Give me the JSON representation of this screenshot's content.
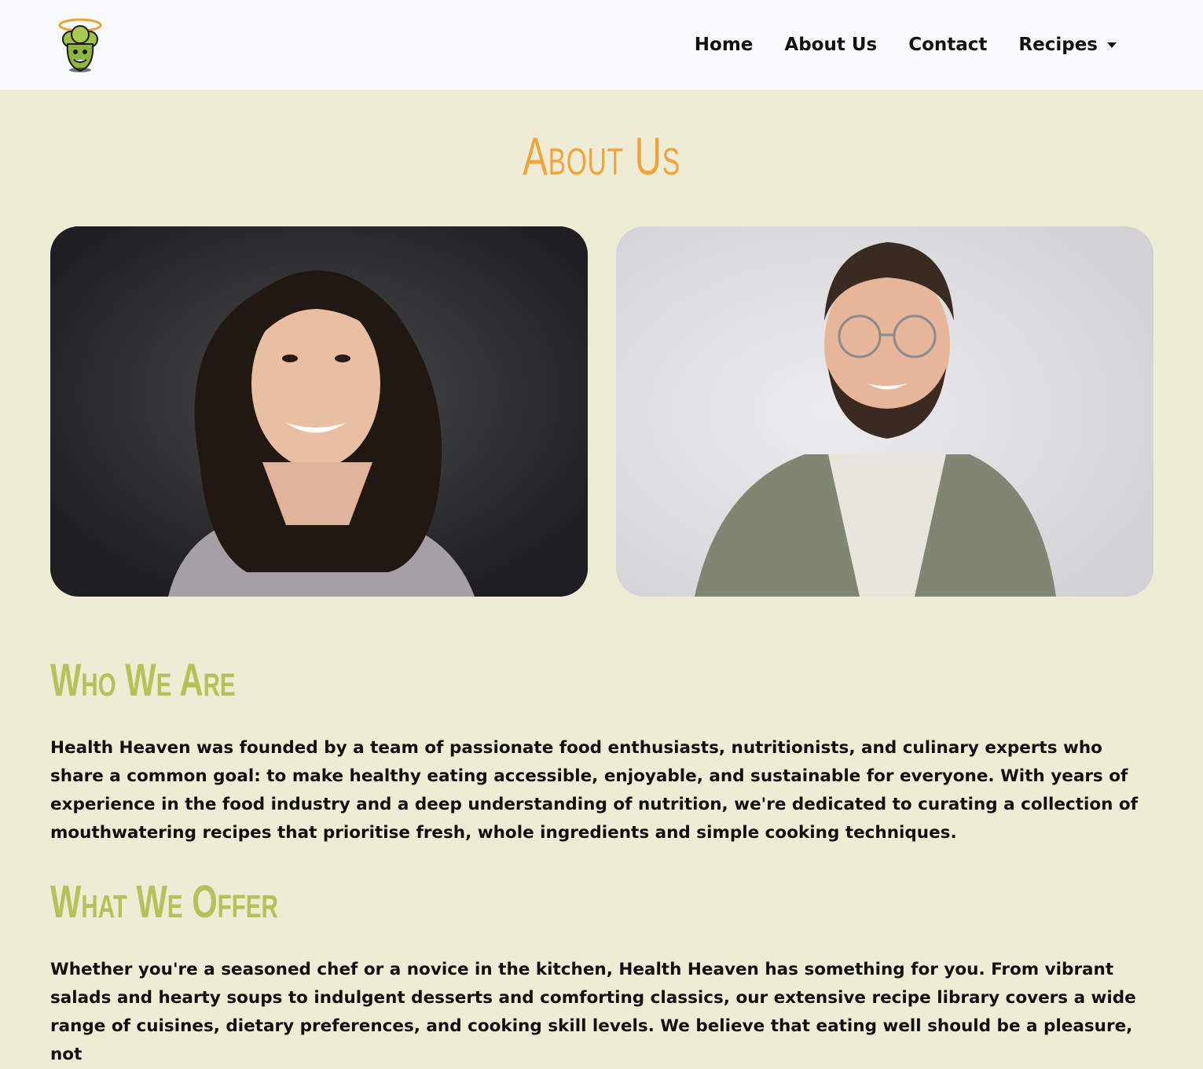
{
  "navbar": {
    "logo_alt": "Health Heaven logo",
    "links": [
      {
        "label": "Home"
      },
      {
        "label": "About Us"
      },
      {
        "label": "Contact"
      },
      {
        "label": "Recipes"
      }
    ]
  },
  "page": {
    "title": "About Us"
  },
  "photos": [
    {
      "alt": "Portrait of a smiling woman with curly dark hair"
    },
    {
      "alt": "Portrait of a smiling bearded man with glasses"
    }
  ],
  "sections": {
    "who": {
      "heading": "Who We Are",
      "body": "Health Heaven was founded by a team of passionate food enthusiasts, nutritionists, and culinary experts who share a common goal: to make healthy eating accessible, enjoyable, and sustainable for everyone. With years of experience in the food industry and a deep understanding of nutrition, we're dedicated to curating a collection of mouthwatering recipes that prioritise fresh, whole ingredients and simple cooking techniques."
    },
    "offer": {
      "heading": "What We Offer",
      "body": "Whether you're a seasoned chef or a novice in the kitchen, Health Heaven has something for you. From vibrant salads and hearty soups to indulgent desserts and comforting classics, our extensive recipe library covers a wide range of cuisines, dietary preferences, and cooking skill levels. We believe that eating well should be a pleasure, not"
    }
  },
  "colors": {
    "page_bg": "#efecd5",
    "navbar_bg": "#f8f9fa",
    "title_orange": "#f0a43c",
    "heading_green": "#b3c35a",
    "text": "#111111"
  }
}
